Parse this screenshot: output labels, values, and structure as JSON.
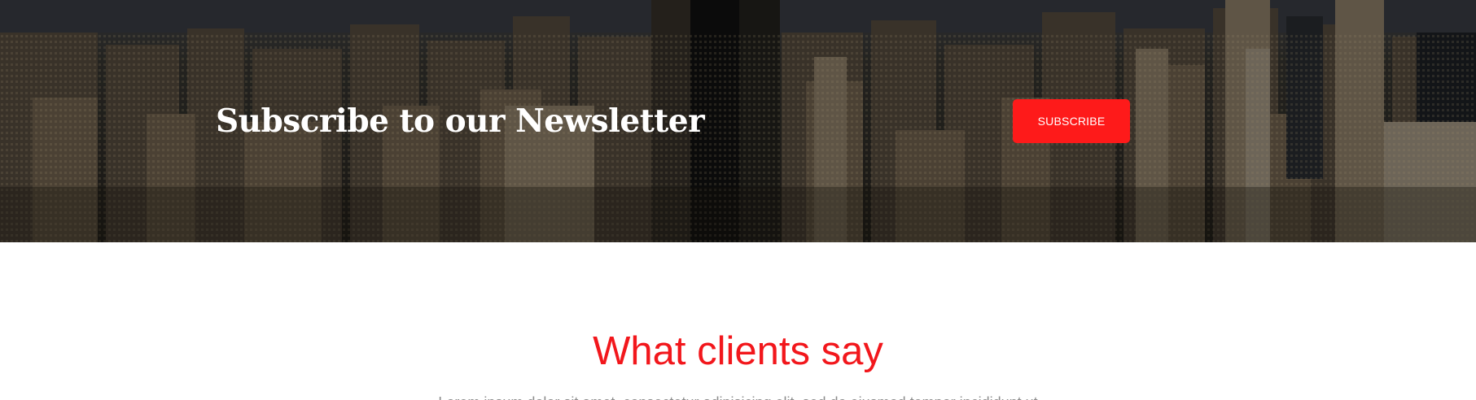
{
  "newsletter": {
    "title": "Subscribe to our Newsletter",
    "button_label": "SUBSCRIBE",
    "background": "city-skyline-photo",
    "button_color": "#fe1a1a"
  },
  "testimonials": {
    "title": "What clients say",
    "description": "Lorem ipsum dolor sit amet, consectetur adipisicing elit, sed do eiusmod tempor incididunt ut",
    "title_color": "#f2171c"
  }
}
